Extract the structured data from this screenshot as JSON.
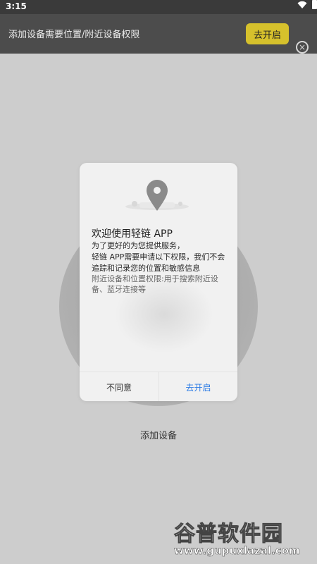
{
  "status_bar": {
    "time": "3:15"
  },
  "banner": {
    "message": "添加设备需要位置/附近设备权限",
    "open_button": "去开启",
    "close_glyph": "×"
  },
  "background": {
    "add_device_label": "添加设备"
  },
  "dialog": {
    "title": "欢迎使用轻链 APP",
    "line1": "为了更好的为您提供服务，",
    "line2": "轻链 APP需要申请以下权限，我们不会",
    "line3": "追踪和记录您的位置和敏感信息",
    "line4": "附近设备和位置权限:用于搜索附近设",
    "line5": "备、蓝牙连接等",
    "disagree_button": "不同意",
    "open_button": "去开启"
  },
  "watermark": {
    "cn": "谷普软件园",
    "en": "www.gupuxlazal.com"
  },
  "colors": {
    "banner_bg": "#4c4c4c",
    "accent_yellow": "#d6c12c",
    "link_blue": "#2c7be5"
  },
  "icons": [
    "wifi-icon",
    "battery-icon",
    "close-circle-icon",
    "location-pin-icon"
  ]
}
